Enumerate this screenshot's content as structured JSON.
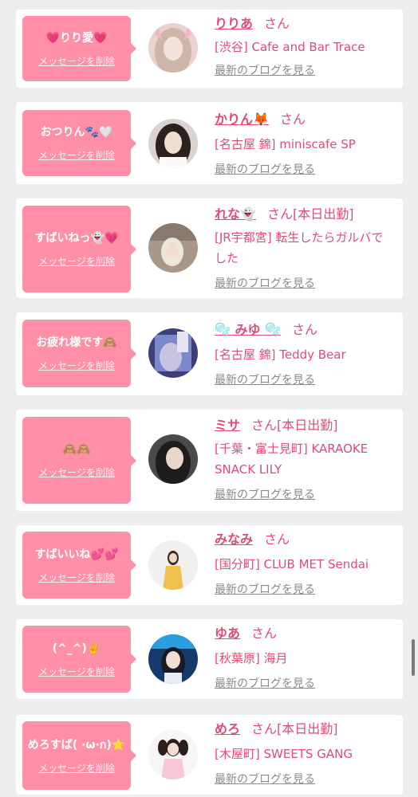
{
  "colors": {
    "accent": "#e14b73",
    "bubble": "#ff8fa6",
    "background": "#ededed",
    "link_gray": "#8a8a8a"
  },
  "cards": [
    {
      "message": "💗りり愛💗",
      "delete_label": "メッセージを削除",
      "name": "りりあ",
      "suffix": "さん",
      "status": "",
      "shop": "[渋谷] Cafe and Bar Trace",
      "blog_link": "最新のブログを見る"
    },
    {
      "message": "おつりん🐾🤍",
      "delete_label": "メッセージを削除",
      "name": "かりん🦊",
      "suffix": "さん",
      "status": "",
      "shop": "[名古屋 錦] miniscafe SP",
      "blog_link": "最新のブログを見る"
    },
    {
      "message": "すばいねっ👻💗",
      "delete_label": "メッセージを削除",
      "name": "れな👻",
      "suffix": "さん",
      "status": "[本日出勤]",
      "shop": "[JR宇都宮] 転生したらガルバでした",
      "blog_link": "最新のブログを見る"
    },
    {
      "message": "お疲れ様です🙈",
      "delete_label": "メッセージを削除",
      "name": "🫧 みゆ 🫧",
      "suffix": "さん",
      "status": "",
      "shop": "[名古屋 錦] Teddy Bear",
      "blog_link": "最新のブログを見る"
    },
    {
      "message": "🙈🙈",
      "delete_label": "メッセージを削除",
      "name": "ミサ",
      "suffix": "さん",
      "status": "[本日出勤]",
      "shop": "[千葉・富士見町] KARAOKE SNACK LILY",
      "blog_link": "最新のブログを見る"
    },
    {
      "message": "すばいいね💕💕",
      "delete_label": "メッセージを削除",
      "name": "みなみ",
      "suffix": "さん",
      "status": "",
      "shop": "[国分町] CLUB MET Sendai",
      "blog_link": "最新のブログを見る"
    },
    {
      "message": "(^_^)✌️",
      "delete_label": "メッセージを削除",
      "name": "ゆあ",
      "suffix": "さん",
      "status": "",
      "shop": "[秋葉原] 海月",
      "blog_link": "最新のブログを見る"
    },
    {
      "message": "めろすば( ·ω·ก)⭐",
      "delete_label": "メッセージを削除",
      "name": "めろ",
      "suffix": "さん",
      "status": "[本日出勤]",
      "shop": "[木屋町] SWEETS GANG",
      "blog_link": "最新のブログを見る"
    }
  ]
}
